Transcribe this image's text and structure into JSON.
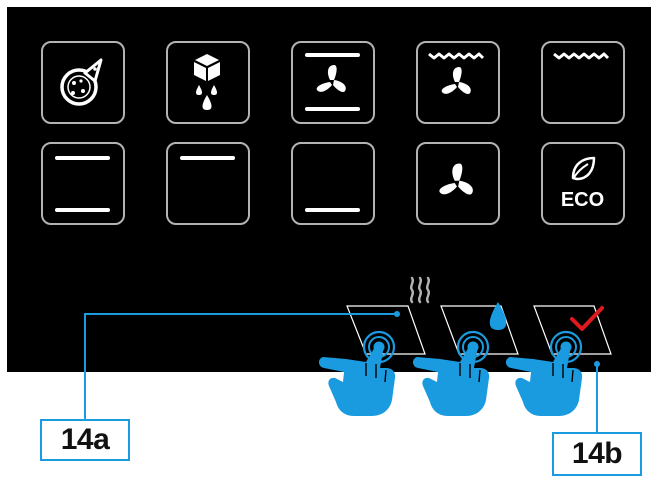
{
  "colors": {
    "panel": "#000000",
    "tile_border": "#b3b3b3",
    "icon": "#ffffff",
    "accent_blue": "#1a9be0",
    "check_red": "#e0191f"
  },
  "mode_tiles": [
    {
      "icon": "pizza-icon"
    },
    {
      "icon": "ice-cube-thaw-icon"
    },
    {
      "icon": "top-bottom-heat-fan-icon"
    },
    {
      "icon": "grill-fan-icon"
    },
    {
      "icon": "grill-icon"
    },
    {
      "icon": "top-bottom-heat-icon"
    },
    {
      "icon": "top-heat-icon"
    },
    {
      "icon": "bottom-heat-icon"
    },
    {
      "icon": "fan-icon"
    },
    {
      "icon": "eco-icon",
      "label": "ECO"
    }
  ],
  "function_keys": [
    {
      "icon": "heat-icon"
    },
    {
      "icon": "water-drop-icon"
    },
    {
      "icon": "checkmark-icon"
    }
  ],
  "callouts": {
    "left": "14a",
    "right": "14b"
  }
}
